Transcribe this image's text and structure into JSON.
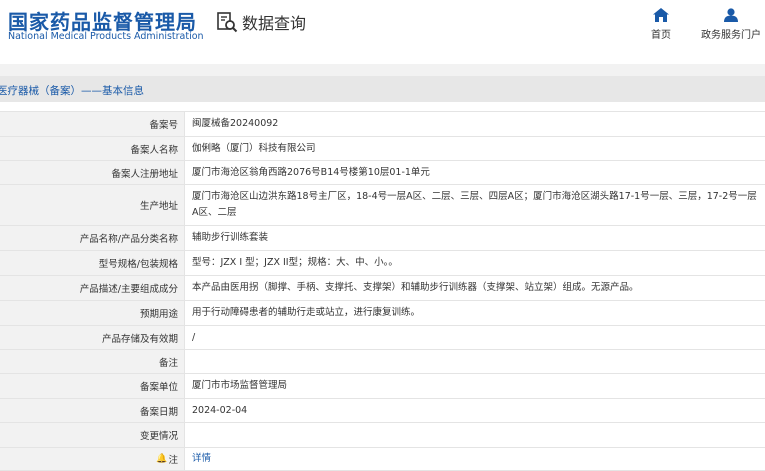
{
  "header": {
    "logo_cn": "国家药品监督管理局",
    "logo_en": "National Medical Products Administration",
    "query_label": "数据查询",
    "nav": {
      "home": "首页",
      "service": "政务服务门户"
    }
  },
  "page_title": "医疗器械（备案）——基本信息",
  "fields": {
    "record_no": {
      "label": "备案号",
      "value": "闽厦械备20240092"
    },
    "filer_name": {
      "label": "备案人名称",
      "value": "伽俐略（厦门）科技有限公司"
    },
    "filer_address": {
      "label": "备案人注册地址",
      "value": "厦门市海沧区翁角西路2076号B14号楼第10层01-1单元"
    },
    "production_address": {
      "label": "生产地址",
      "value": "厦门市海沧区山边洪东路18号主厂区，18-4号一层A区、二层、三层、四层A区；厦门市海沧区湖头路17-1号一层、三层，17-2号一层A区、二层"
    },
    "product_name": {
      "label": "产品名称/产品分类名称",
      "value": "辅助步行训练套装"
    },
    "model_spec": {
      "label": "型号规格/包装规格",
      "value": "型号：JZX I 型；JZX II型；规格：大、中、小。。"
    },
    "description": {
      "label": "产品描述/主要组成成分",
      "value": "本产品由医用拐（脚撑、手柄、支撑托、支撑架）和辅助步行训练器（支撑架、站立架）组成。无源产品。"
    },
    "intended_use": {
      "label": "预期用途",
      "value": "用于行动障碍患者的辅助行走或站立，进行康复训练。"
    },
    "storage": {
      "label": "产品存储及有效期",
      "value": "/"
    },
    "remarks": {
      "label": "备注",
      "value": ""
    },
    "record_unit": {
      "label": "备案单位",
      "value": "厦门市市场监督管理局"
    },
    "record_date": {
      "label": "备案日期",
      "value": "2024-02-04"
    },
    "change_info": {
      "label": "变更情况",
      "value": ""
    },
    "notes": {
      "label": "注",
      "icon": "bell-icon",
      "link": "详情"
    }
  },
  "colors": {
    "brand": "#1a5aa8",
    "label_bg": "#f2f2f2",
    "title_bg": "#e7e7e7",
    "border": "#e4e4e4"
  }
}
